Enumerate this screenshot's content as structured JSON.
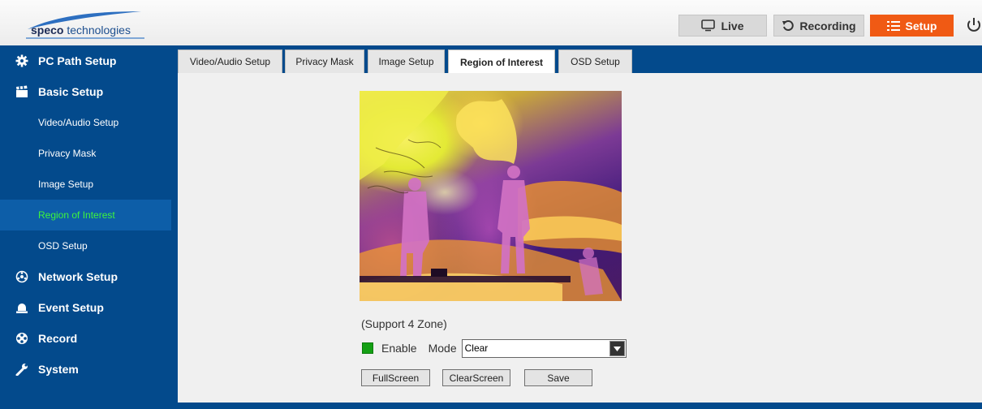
{
  "header": {
    "logo_bold": "speco",
    "logo_light": " technologies",
    "buttons": {
      "live": "Live",
      "recording": "Recording",
      "setup": "Setup"
    }
  },
  "sidebar": {
    "sections": [
      {
        "label": "PC Path Setup",
        "icon": "gear-icon"
      },
      {
        "label": "Basic Setup",
        "icon": "clapperboard-icon"
      },
      {
        "label": "Network Setup",
        "icon": "network-icon"
      },
      {
        "label": "Event Setup",
        "icon": "alarm-icon"
      },
      {
        "label": "Record",
        "icon": "film-reel-icon"
      },
      {
        "label": "System",
        "icon": "wrench-icon"
      }
    ],
    "subitems": [
      "Video/Audio Setup",
      "Privacy Mask",
      "Image Setup",
      "Region of Interest",
      "OSD Setup"
    ],
    "active_subitem": "Region of Interest"
  },
  "tabs": [
    "Video/Audio Setup",
    "Privacy Mask",
    "Image Setup",
    "Region of Interest",
    "OSD Setup"
  ],
  "active_tab": "Region of Interest",
  "roi": {
    "support_text": "(Support 4 Zone)",
    "enable_label": "Enable",
    "enable_checked": true,
    "mode_label": "Mode",
    "mode_value": "Clear",
    "buttons": {
      "fullscreen": "FullScreen",
      "clearscreen": "ClearScreen",
      "save": "Save"
    }
  },
  "colors": {
    "sidebar_bg": "#034a8c",
    "setup_accent": "#f05a14",
    "active_text": "#3df53d",
    "enable_green": "#14a014"
  }
}
